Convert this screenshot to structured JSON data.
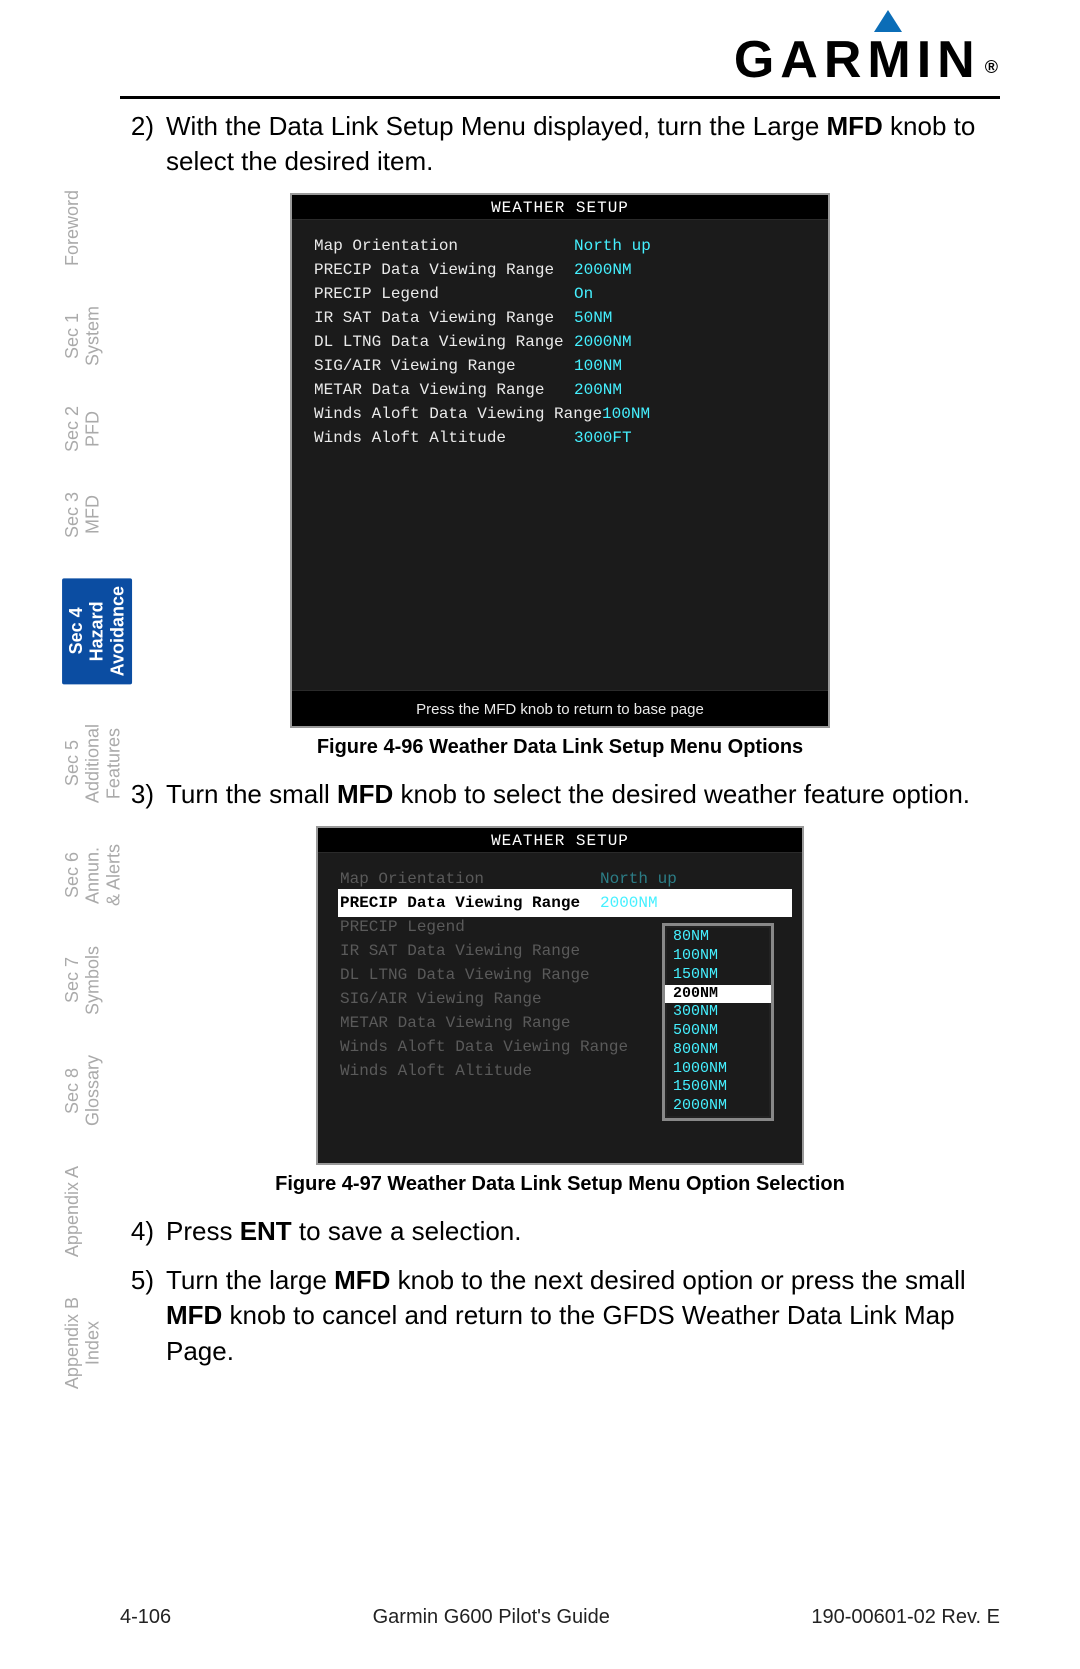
{
  "logo_text": "GARMIN",
  "sidebar": [
    {
      "line1": "",
      "line2": "Foreword",
      "active": false
    },
    {
      "line1": "Sec 1",
      "line2": "System",
      "active": false
    },
    {
      "line1": "Sec 2",
      "line2": "PFD",
      "active": false
    },
    {
      "line1": "Sec 3",
      "line2": "MFD",
      "active": false
    },
    {
      "line1": "Sec 4",
      "line2": "Hazard\nAvoidance",
      "active": true
    },
    {
      "line1": "Sec 5",
      "line2": "Additional\nFeatures",
      "active": false
    },
    {
      "line1": "Sec 6",
      "line2": "Annun.\n& Alerts",
      "active": false
    },
    {
      "line1": "Sec 7",
      "line2": "Symbols",
      "active": false
    },
    {
      "line1": "Sec 8",
      "line2": "Glossary",
      "active": false
    },
    {
      "line1": "",
      "line2": "Appendix A",
      "active": false
    },
    {
      "line1": "Appendix B",
      "line2": "Index",
      "active": false
    }
  ],
  "steps": {
    "s2_num": "2)",
    "s2_pre": "With the Data Link Setup Menu displayed, turn the Large ",
    "s2_bold": "MFD",
    "s2_post": " knob to select the desired item.",
    "s3_num": "3)",
    "s3_pre": "Turn the small ",
    "s3_bold": "MFD",
    "s3_post": " knob to select the desired weather feature option.",
    "s4_num": "4)",
    "s4_pre": "Press ",
    "s4_bold": "ENT",
    "s4_post": " to save a selection.",
    "s5_num": "5)",
    "s5_pre": "Turn the large ",
    "s5_bold1": "MFD",
    "s5_mid": " knob to the next desired option or press the small ",
    "s5_bold2": "MFD",
    "s5_post": " knob to cancel and return to the GFDS Weather Data Link Map Page."
  },
  "screen1": {
    "title": "WEATHER SETUP",
    "rows": [
      {
        "label": "Map Orientation",
        "val": "North up"
      },
      {
        "label": "PRECIP Data Viewing Range",
        "val": "2000NM"
      },
      {
        "label": "PRECIP Legend",
        "val": "On"
      },
      {
        "label": "IR SAT Data Viewing Range",
        "val": "50NM"
      },
      {
        "label": "DL LTNG Data Viewing Range",
        "val": "2000NM"
      },
      {
        "label": "SIG/AIR Viewing Range",
        "val": "100NM"
      },
      {
        "label": "METAR Data Viewing Range",
        "val": "200NM"
      },
      {
        "label": "Winds Aloft Data Viewing Range",
        "val": "100NM"
      },
      {
        "label": "Winds Aloft Altitude",
        "val": "3000FT"
      }
    ],
    "footer": "Press the MFD knob to return to base page"
  },
  "caption1": "Figure 4-96  Weather Data Link Setup Menu Options",
  "screen2": {
    "title": "WEATHER SETUP",
    "rows": [
      {
        "label": "Map Orientation",
        "val": "North up",
        "dim": true
      },
      {
        "label": "PRECIP Data Viewing Range",
        "val": "2000NM",
        "selected": true
      },
      {
        "label": "PRECIP Legend",
        "val": "",
        "dim": true
      },
      {
        "label": "IR SAT Data Viewing Range",
        "val": "",
        "dim": true
      },
      {
        "label": "DL LTNG Data Viewing Range",
        "val": "",
        "dim": true
      },
      {
        "label": "SIG/AIR Viewing Range",
        "val": "",
        "dim": true
      },
      {
        "label": "METAR Data Viewing Range",
        "val": "",
        "dim": true
      },
      {
        "label": "Winds Aloft Data Viewing Range",
        "val": "",
        "dim": true
      },
      {
        "label": "Winds Aloft Altitude",
        "val": "",
        "dim": true
      }
    ],
    "popup": [
      "80NM",
      "100NM",
      "150NM",
      "200NM",
      "300NM",
      "500NM",
      "800NM",
      "1000NM",
      "1500NM",
      "2000NM"
    ],
    "popup_selected": "200NM"
  },
  "caption2": "Figure 4-97  Weather Data Link Setup Menu Option Selection",
  "footer": {
    "page": "4-106",
    "title": "Garmin G600 Pilot's Guide",
    "doc": "190-00601-02  Rev. E"
  }
}
